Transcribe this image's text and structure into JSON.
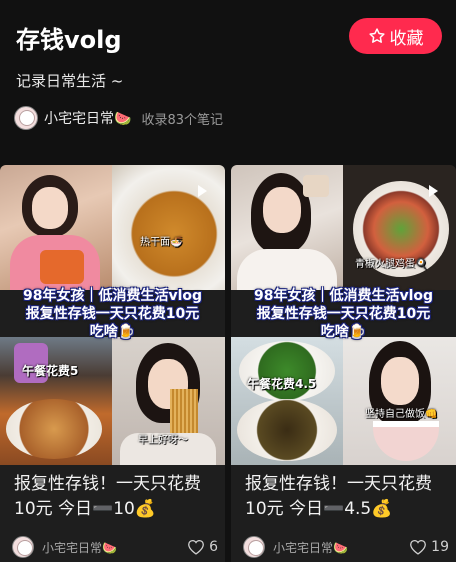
{
  "header": {
    "title": "存钱volg",
    "favorite_label": "收藏",
    "description": "记录日常生活 ~",
    "author": "小宅宅日常🍉",
    "collected_text": "收录83个笔记"
  },
  "cards": [
    {
      "overlay_title_line1": "98年女孩｜低消费生活vlog",
      "overlay_title_line2": "报复性存钱一天只花费10元",
      "overlay_title_line3": "吃啥🍺",
      "tag_noodle": "热干面🍜",
      "lunch_label": "午餐花费5",
      "tag_morning": "早上好呀～",
      "title": "报复性存钱！一天只花费10元 今日➖10💰",
      "author": "小宅宅日常🍉",
      "likes": "6"
    },
    {
      "overlay_title_line1": "98年女孩｜低消费生活vlog",
      "overlay_title_line2": "报复性存钱一天只花费10元",
      "overlay_title_line3": "吃啥🍺",
      "tag_dish": "青椒火腿鸡蛋🍳",
      "lunch_label": "午餐花费4.5",
      "tag_cook": "坚持自己做饭👊",
      "title": "报复性存钱！一天只花费10元 今日➖4.5💰",
      "author": "小宅宅日常🍉",
      "likes": "19"
    }
  ],
  "colors": {
    "background": "#111111",
    "accent": "#ff2a4e",
    "card": "#1e1e1e"
  }
}
